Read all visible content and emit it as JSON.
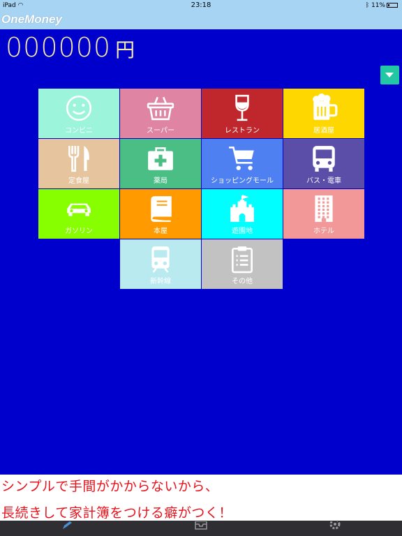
{
  "status_bar": {
    "device": "iPad",
    "wifi_icon": "wifi-icon",
    "time": "23:18",
    "bluetooth_icon": "bluetooth-icon",
    "battery": "11%"
  },
  "nav": {
    "title": "OneMoney"
  },
  "amount": {
    "value": "000000",
    "currency": "円"
  },
  "dropdown": {
    "icon": "chevron-down-icon",
    "color": "#22c7a4"
  },
  "categories": [
    {
      "label": "コンビニ",
      "icon": "smiley-icon",
      "color": "#9cf5da"
    },
    {
      "label": "スーパー",
      "icon": "basket-icon",
      "color": "#df84a3"
    },
    {
      "label": "レストラン",
      "icon": "wine-glass-icon",
      "color": "#c0272d"
    },
    {
      "label": "居酒屋",
      "icon": "beer-mug-icon",
      "color": "#ffd700"
    },
    {
      "label": "定食屋",
      "icon": "fork-knife-icon",
      "color": "#e6c59e"
    },
    {
      "label": "薬局",
      "icon": "first-aid-kit-icon",
      "color": "#4bbe86"
    },
    {
      "label": "ショッピングモール",
      "icon": "shopping-cart-icon",
      "color": "#4f80f2"
    },
    {
      "label": "バス・電車",
      "icon": "bus-icon",
      "color": "#5a4ea8"
    },
    {
      "label": "ガソリン",
      "icon": "car-icon",
      "color": "#88ff00"
    },
    {
      "label": "本屋",
      "icon": "book-icon",
      "color": "#ff9b00"
    },
    {
      "label": "遊園地",
      "icon": "castle-icon",
      "color": "#00ffff"
    },
    {
      "label": "ホテル",
      "icon": "hotel-building-icon",
      "color": "#f29898"
    },
    {
      "label": "新幹線",
      "icon": "train-icon",
      "color": "#b8eaf0"
    },
    {
      "label": "その他",
      "icon": "clipboard-icon",
      "color": "#c2c2c2"
    }
  ],
  "promo": {
    "line1": "シンプルで手間がかからないから、",
    "line2": "長続きして家計簿をつける癖がつく！"
  },
  "tab_bar": {
    "icons": [
      "pencil-icon",
      "inbox-icon",
      "gear-icon"
    ]
  },
  "colors": {
    "background": "#0000cc",
    "header": "#a8d4f4",
    "amount_text": "#f3e7a8",
    "promo_text": "#e8121c"
  }
}
